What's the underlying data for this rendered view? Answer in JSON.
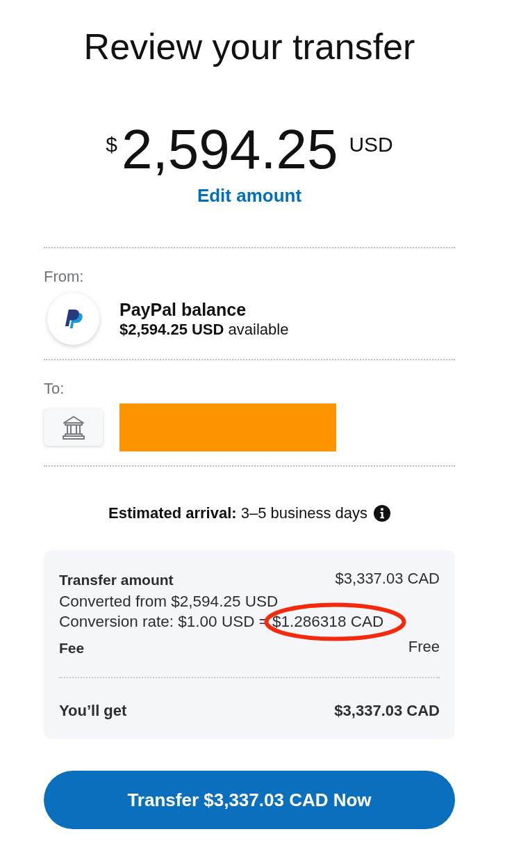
{
  "title": "Review your transfer",
  "amount": {
    "symbol": "$",
    "value": "2,594.25",
    "currency": "USD",
    "edit_link": "Edit amount"
  },
  "from": {
    "label": "From:",
    "account_name": "PayPal balance",
    "balance": "**$2,594.25 USD** available"
  },
  "to": {
    "label": "To:",
    "recipient_redacted": true
  },
  "arrival": "**Estimated arrival:** 3–5 business days",
  "summary": {
    "items": [
      {
        "kind": "line",
        "label": "Transfer amount",
        "value": "$3,337.03 CAD"
      },
      {
        "kind": "note",
        "text": "Converted from $2,594.25 USD",
        "circled": false
      },
      {
        "kind": "note",
        "text": "Conversion rate: $1.00 USD = $1.286318 CAD",
        "circled": true
      },
      {
        "kind": "line",
        "label": "Fee",
        "value": "Free"
      }
    ],
    "total": {
      "label": "You’ll get",
      "value": "$3,337.03 CAD"
    }
  },
  "button": "Transfer $3,337.03 CAD Now"
}
